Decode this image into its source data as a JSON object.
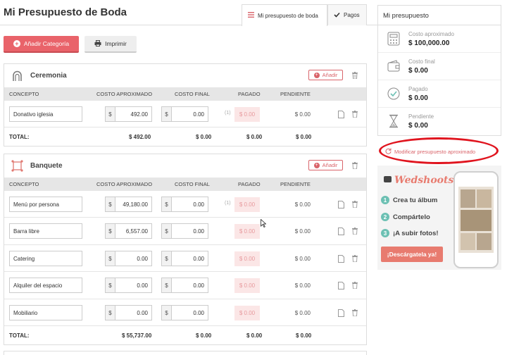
{
  "header": {
    "title": "Mi Presupuesto de Boda",
    "tabs": [
      {
        "label": "Mi presupuesto de boda",
        "icon": "list-icon"
      },
      {
        "label": "Pagos",
        "icon": "check-icon"
      }
    ]
  },
  "toolbar": {
    "add_category_label": "Añadir Categoría",
    "print_label": "Imprimir"
  },
  "columns": {
    "concepto": "CONCEPTO",
    "costo_aprox": "COSTO APROXIMADO",
    "costo_final": "COSTO FINAL",
    "pagado": "PAGADO",
    "pendiente": "PENDIENTE"
  },
  "currency_symbol": "$",
  "add_label": "Añadir",
  "total_label": "TOTAL:",
  "categories": [
    {
      "name": "Ceremonia",
      "icon": "arch-icon",
      "rows": [
        {
          "concepto": "Donativo iglesia",
          "aprox": "492.00",
          "final": "0.00",
          "pagado_count": "(1)",
          "pagado": "$ 0.00",
          "pendiente": "$ 0.00"
        }
      ],
      "totals": {
        "aprox": "$ 492.00",
        "final": "$ 0.00",
        "pagado": "$ 0.00",
        "pendiente": "$ 0.00"
      }
    },
    {
      "name": "Banquete",
      "icon": "table-icon",
      "rows": [
        {
          "concepto": "Menú por persona",
          "aprox": "49,180.00",
          "final": "0.00",
          "pagado_count": "(1)",
          "pagado": "$ 0.00",
          "pendiente": "$ 0.00"
        },
        {
          "concepto": "Barra libre",
          "aprox": "6,557.00",
          "final": "0.00",
          "pagado_count": "",
          "pagado": "$ 0.00",
          "pendiente": "$ 0.00"
        },
        {
          "concepto": "Catering",
          "aprox": "0.00",
          "final": "0.00",
          "pagado_count": "",
          "pagado": "$ 0.00",
          "pendiente": "$ 0.00"
        },
        {
          "concepto": "Alquiler del espacio",
          "aprox": "0.00",
          "final": "0.00",
          "pagado_count": "",
          "pagado": "$ 0.00",
          "pendiente": "$ 0.00"
        },
        {
          "concepto": "Mobiliario",
          "aprox": "0.00",
          "final": "0.00",
          "pagado_count": "",
          "pagado": "$ 0.00",
          "pendiente": "$ 0.00"
        }
      ],
      "totals": {
        "aprox": "$ 55,737.00",
        "final": "$ 0.00",
        "pagado": "$ 0.00",
        "pendiente": "$ 0.00"
      }
    }
  ],
  "sidebar": {
    "title": "Mi presupuesto",
    "items": [
      {
        "label": "Costo aproximado",
        "value": "$ 100,000.00",
        "icon": "calculator-icon"
      },
      {
        "label": "Costo final",
        "value": "$ 0.00",
        "icon": "wallet-icon"
      },
      {
        "label": "Pagado",
        "value": "$ 0.00",
        "icon": "check-circle-icon"
      },
      {
        "label": "Pendiente",
        "value": "$ 0.00",
        "icon": "hourglass-icon"
      }
    ],
    "modify_label": "Modificar presupuesto aproximado"
  },
  "ad": {
    "brand": "Wedshoots",
    "steps": [
      {
        "num": "1",
        "text": "Crea tu álbum"
      },
      {
        "num": "2",
        "text": "Compártelo"
      },
      {
        "num": "3",
        "text": "¡A subir fotos!"
      }
    ],
    "cta": "¡Descárgatela ya!"
  },
  "colors": {
    "accent": "#e9636a",
    "highlight": "#e0141e",
    "pagado_bg": "#fbe6e6",
    "ad_accent": "#e87b6f",
    "step_green": "#6cc0b3"
  }
}
